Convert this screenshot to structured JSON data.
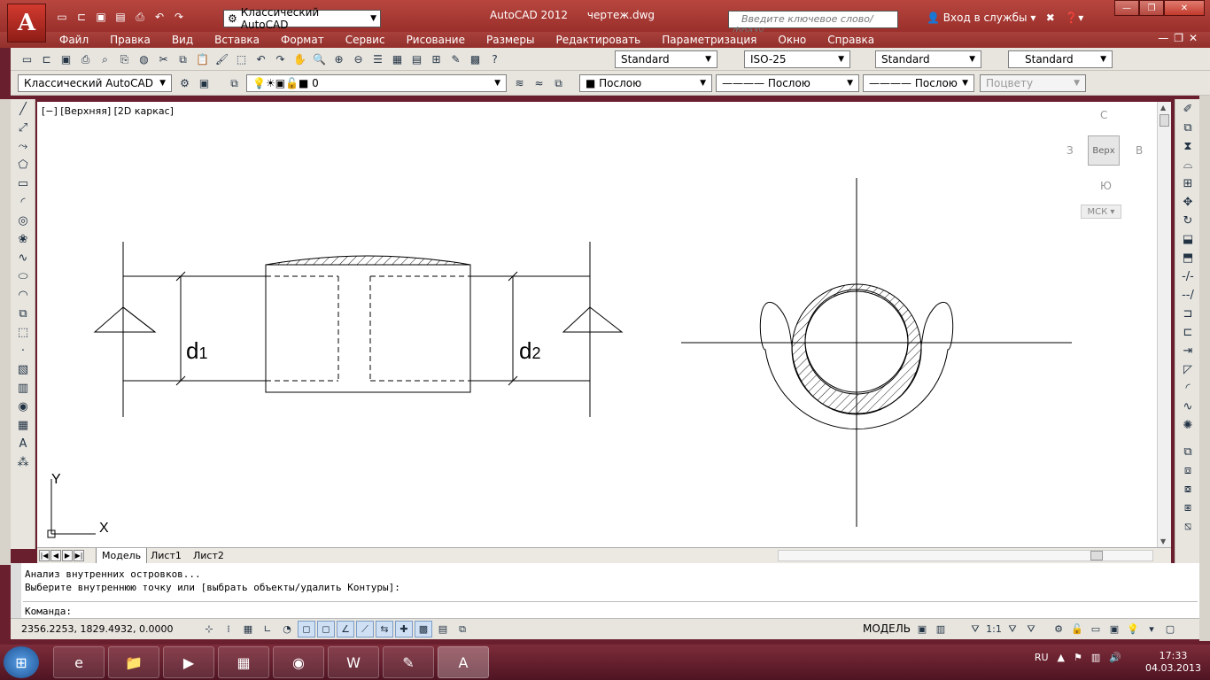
{
  "window": {
    "app_name": "AutoCAD 2012",
    "file_name": "чертеж.dwg",
    "workspace": "Классический AutoCAD",
    "search_placeholder": "Введите ключевое слово/фразу",
    "login": "Вход в службы"
  },
  "menu": [
    "Файл",
    "Правка",
    "Вид",
    "Вставка",
    "Формат",
    "Сервис",
    "Рисование",
    "Размеры",
    "Редактировать",
    "Параметризация",
    "Окно",
    "Справка"
  ],
  "styles": {
    "text_style": "Standard",
    "dim_style": "ISO-25",
    "table_style": "Standard",
    "multileader_style": "Standard"
  },
  "layers": {
    "workspace": "Классический AutoCAD",
    "current_layer": "0",
    "color": "Послою",
    "linetype": "Послою",
    "lineweight": "Послою",
    "plot_style": "Поцвету"
  },
  "viewport": {
    "label": "[−] [Верхняя] [2D каркас]",
    "viewcube": {
      "north": "С",
      "south": "Ю",
      "west": "З",
      "east": "В",
      "face": "Верх",
      "ucs": "МСК"
    },
    "ucs_x": "X",
    "ucs_y": "Y"
  },
  "drawing": {
    "d1_main": "d",
    "d1_sub": "1",
    "d2_main": "d",
    "d2_sub": "2"
  },
  "tabs": [
    "Модель",
    "Лист1",
    "Лист2"
  ],
  "command": {
    "history": [
      "Анализ внутренних островков...",
      "Выберите внутреннюю точку или [выбрать объекты/удалить Контуры]:"
    ],
    "prompt": "Команда:"
  },
  "status": {
    "coords": "2356.2253, 1829.4932, 0.0000",
    "model": "МОДЕЛЬ",
    "scale": "1:1"
  },
  "taskbar": {
    "lang": "RU",
    "time": "17:33",
    "date": "04.03.2013"
  }
}
